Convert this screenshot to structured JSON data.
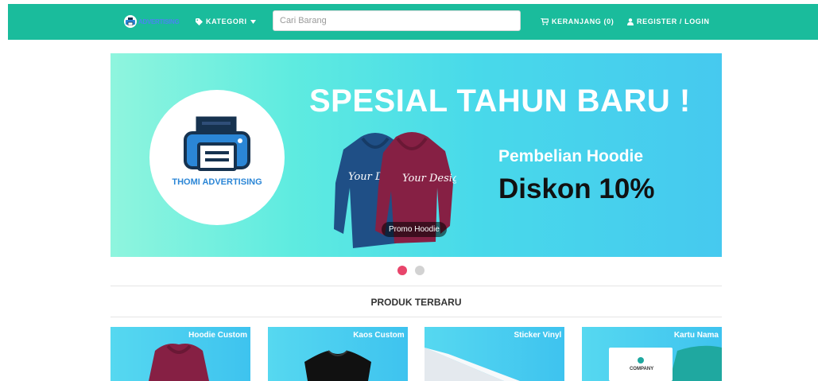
{
  "navbar": {
    "brand_text": "ADVERTISING",
    "kategori_label": "KATEGORI",
    "search_placeholder": "Cari Barang",
    "cart_label": "KERANJANG (0)",
    "login_label": "REGISTER / LOGIN",
    "color": "#1abc9c"
  },
  "banner": {
    "headline": "SPESIAL TAHUN BARU !",
    "subtitle": "Pembelian Hoodie",
    "discount": "Diskon 10%",
    "brand_name": "THOMI ADVERTISING",
    "hoodie_print_1": "Your Design",
    "hoodie_print_2": "Your Design",
    "caption": "Promo Hoodie",
    "slide_count": 2,
    "active_slide": 1
  },
  "section": {
    "title": "PRODUK TERBARU"
  },
  "products": [
    {
      "name": "Hoodie Custom"
    },
    {
      "name": "Kaos Custom"
    },
    {
      "name": "Sticker Vinyl"
    },
    {
      "name": "Kartu Nama",
      "image_text": "COMPANY"
    }
  ],
  "colors": {
    "accent": "#1abc9c",
    "dot_active": "#e8456b",
    "dot_inactive": "#d2d2d2",
    "brand_blue": "#2b86d6"
  }
}
